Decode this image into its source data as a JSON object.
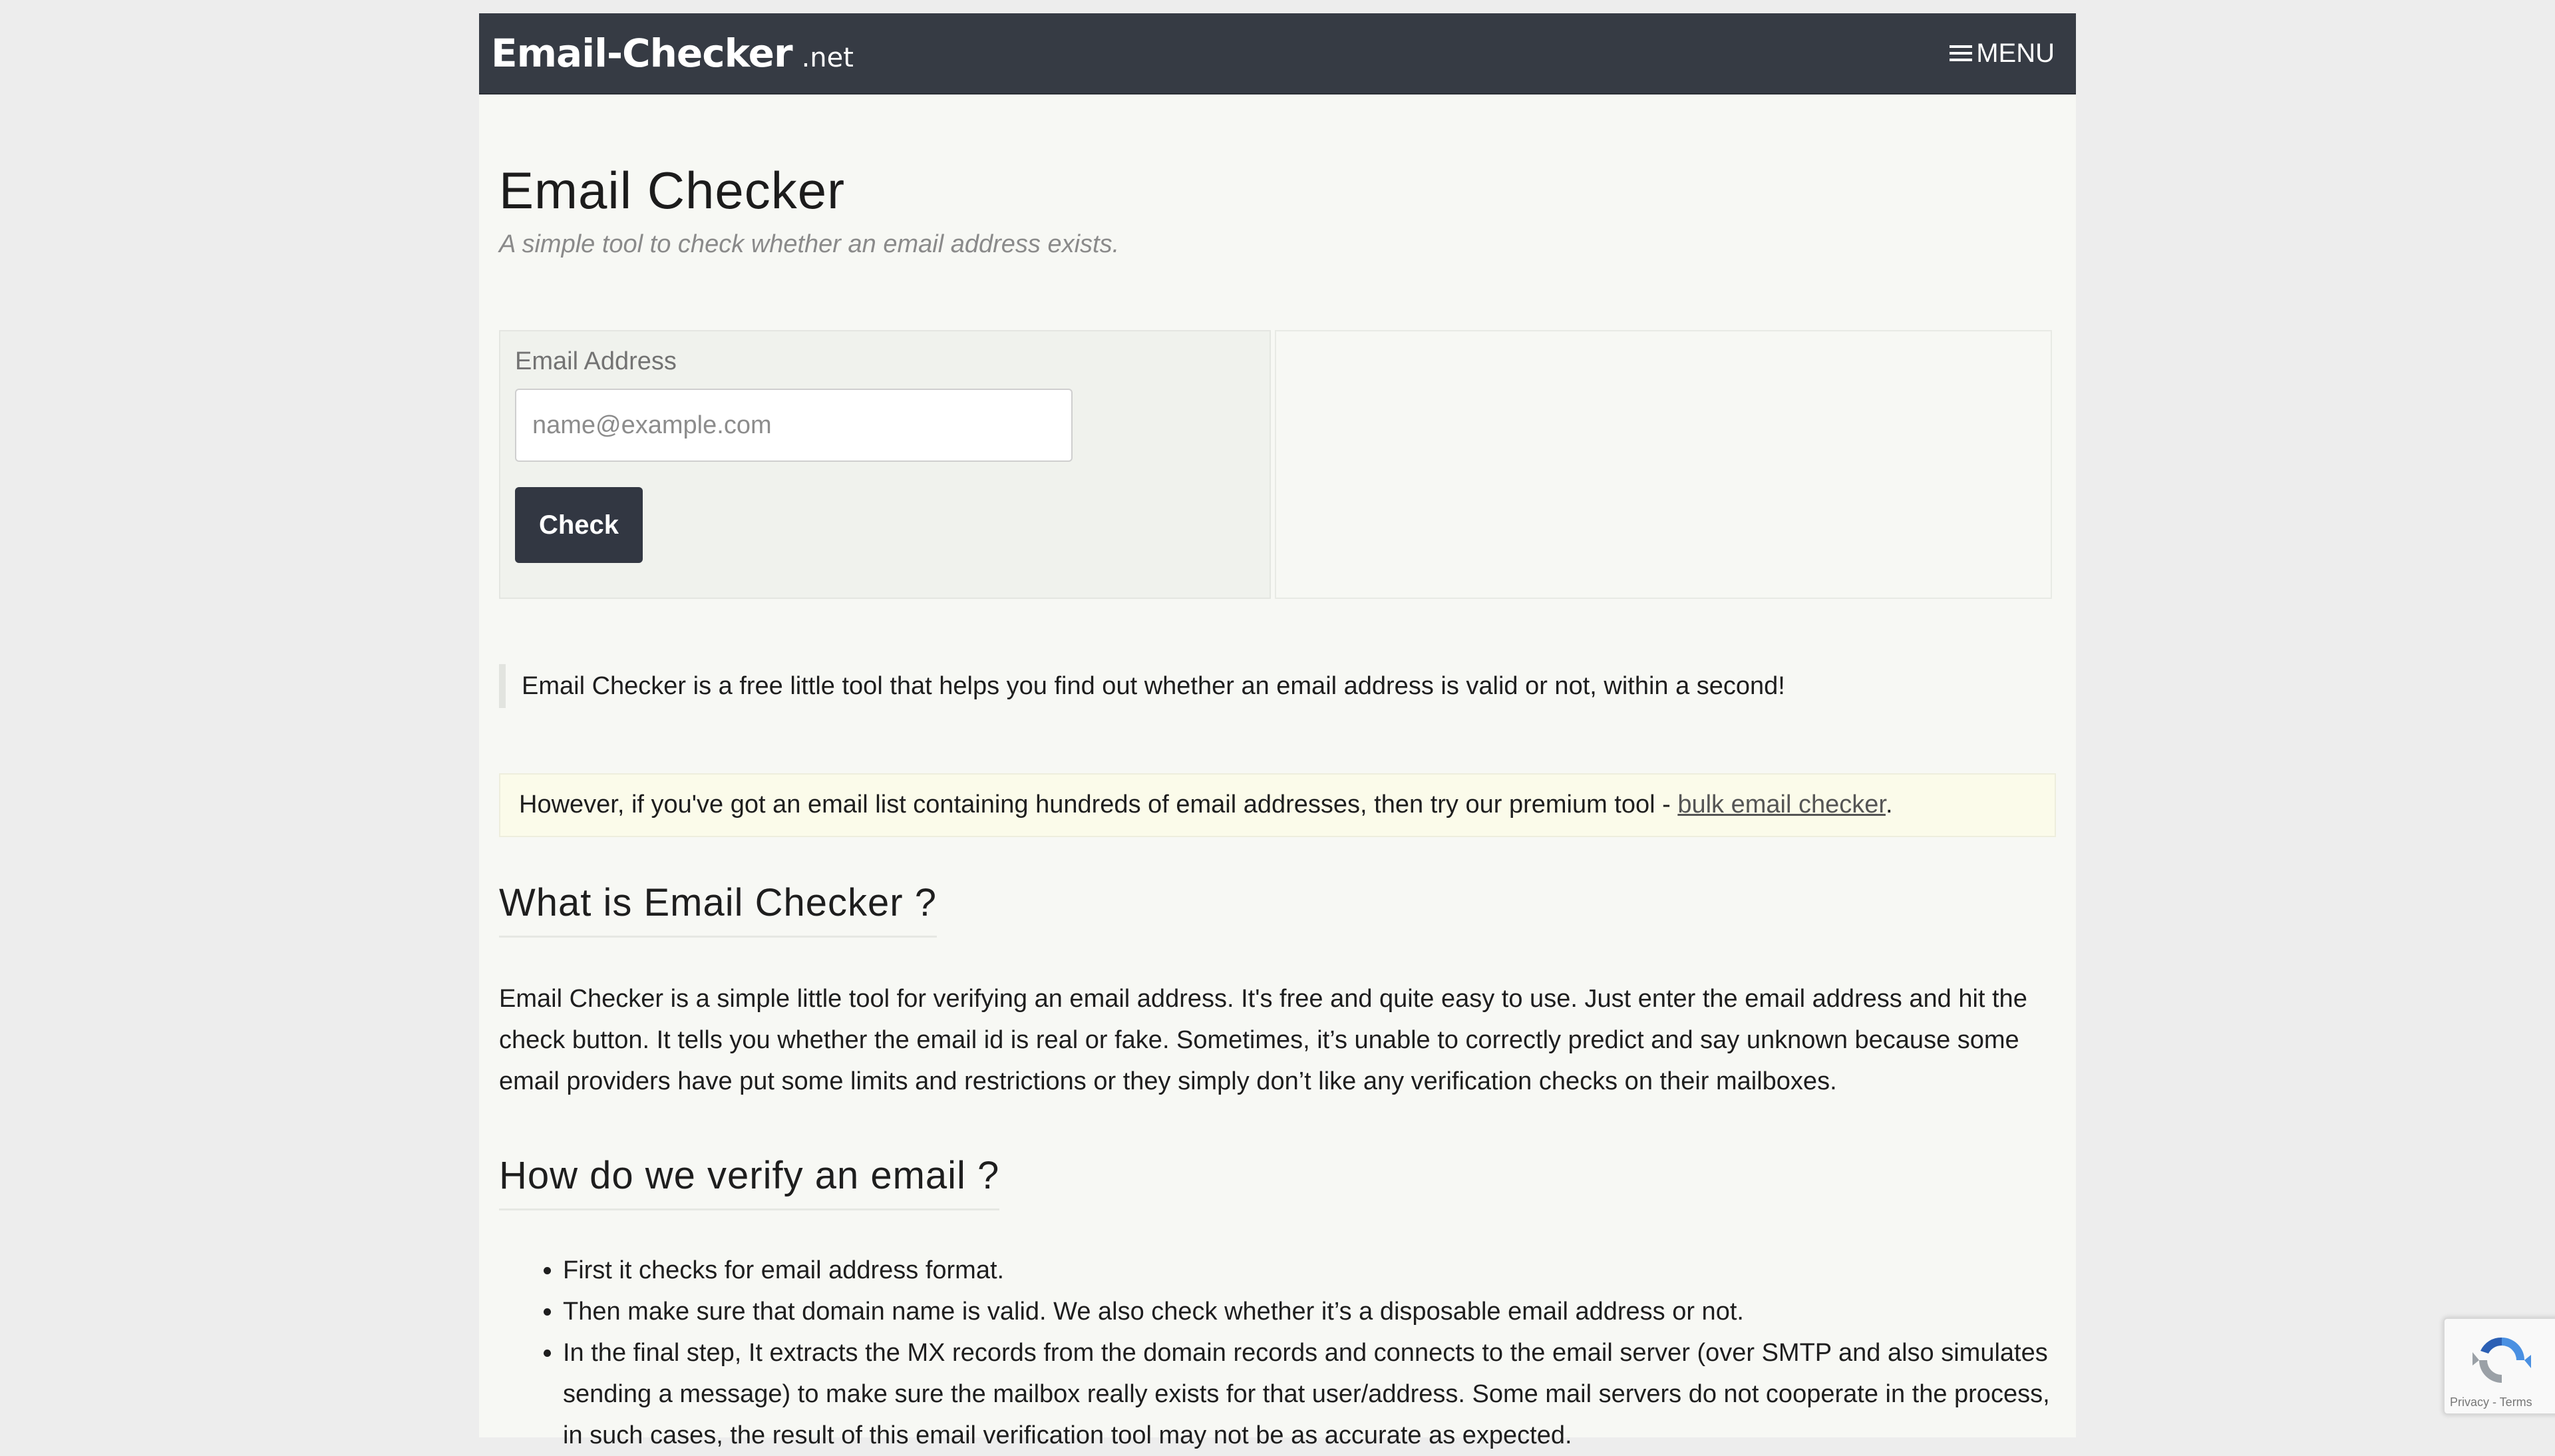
{
  "navbar": {
    "brand_main": "Email-Checker",
    "brand_tld": ".net",
    "menu_icon": "hamburger-icon",
    "menu_label": "MENU"
  },
  "header": {
    "title": "Email Checker",
    "subtitle": "A simple tool to check whether an email address exists."
  },
  "form": {
    "label": "Email Address",
    "placeholder": "name@example.com",
    "value": "",
    "button_label": "Check"
  },
  "intro": {
    "text": "Email Checker is a free little tool that helps you find out whether an email address is valid or not, within a second!"
  },
  "notice": {
    "text": "However, if you've got an email list containing hundreds of email addresses, then try our premium tool - ",
    "link_text": "bulk email checker",
    "suffix": "."
  },
  "sections": {
    "what": {
      "heading": "What is Email Checker ?",
      "body": "Email Checker is a simple little tool for verifying an email address. It's free and quite easy to use. Just enter the email address and hit the check button. It tells you whether the email id is real or fake. Sometimes, it’s unable to correctly predict and say unknown because some email providers have put some limits and restrictions or they simply don’t like any verification checks on their mailboxes."
    },
    "how": {
      "heading": "How do we verify an email ?",
      "steps": [
        "First it checks for email address format.",
        "Then make sure that domain name is valid. We also check whether it’s a disposable email address or not.",
        "In the final step, It extracts the MX records from the domain records and connects to the email server (over SMTP and also simulates sending a message) to make sure the mailbox really exists for that user/address. Some mail servers do not cooperate in the process, in such cases, the result of this email verification tool may not be as accurate as expected."
      ]
    }
  },
  "recaptcha": {
    "icon": "recaptcha-icon",
    "links": "Privacy - Terms"
  },
  "colors": {
    "navbar_bg": "#363b44",
    "button_bg": "#323742",
    "page_bg": "#ededed",
    "content_bg": "#f7f8f4",
    "notice_bg": "#fbfbea"
  }
}
